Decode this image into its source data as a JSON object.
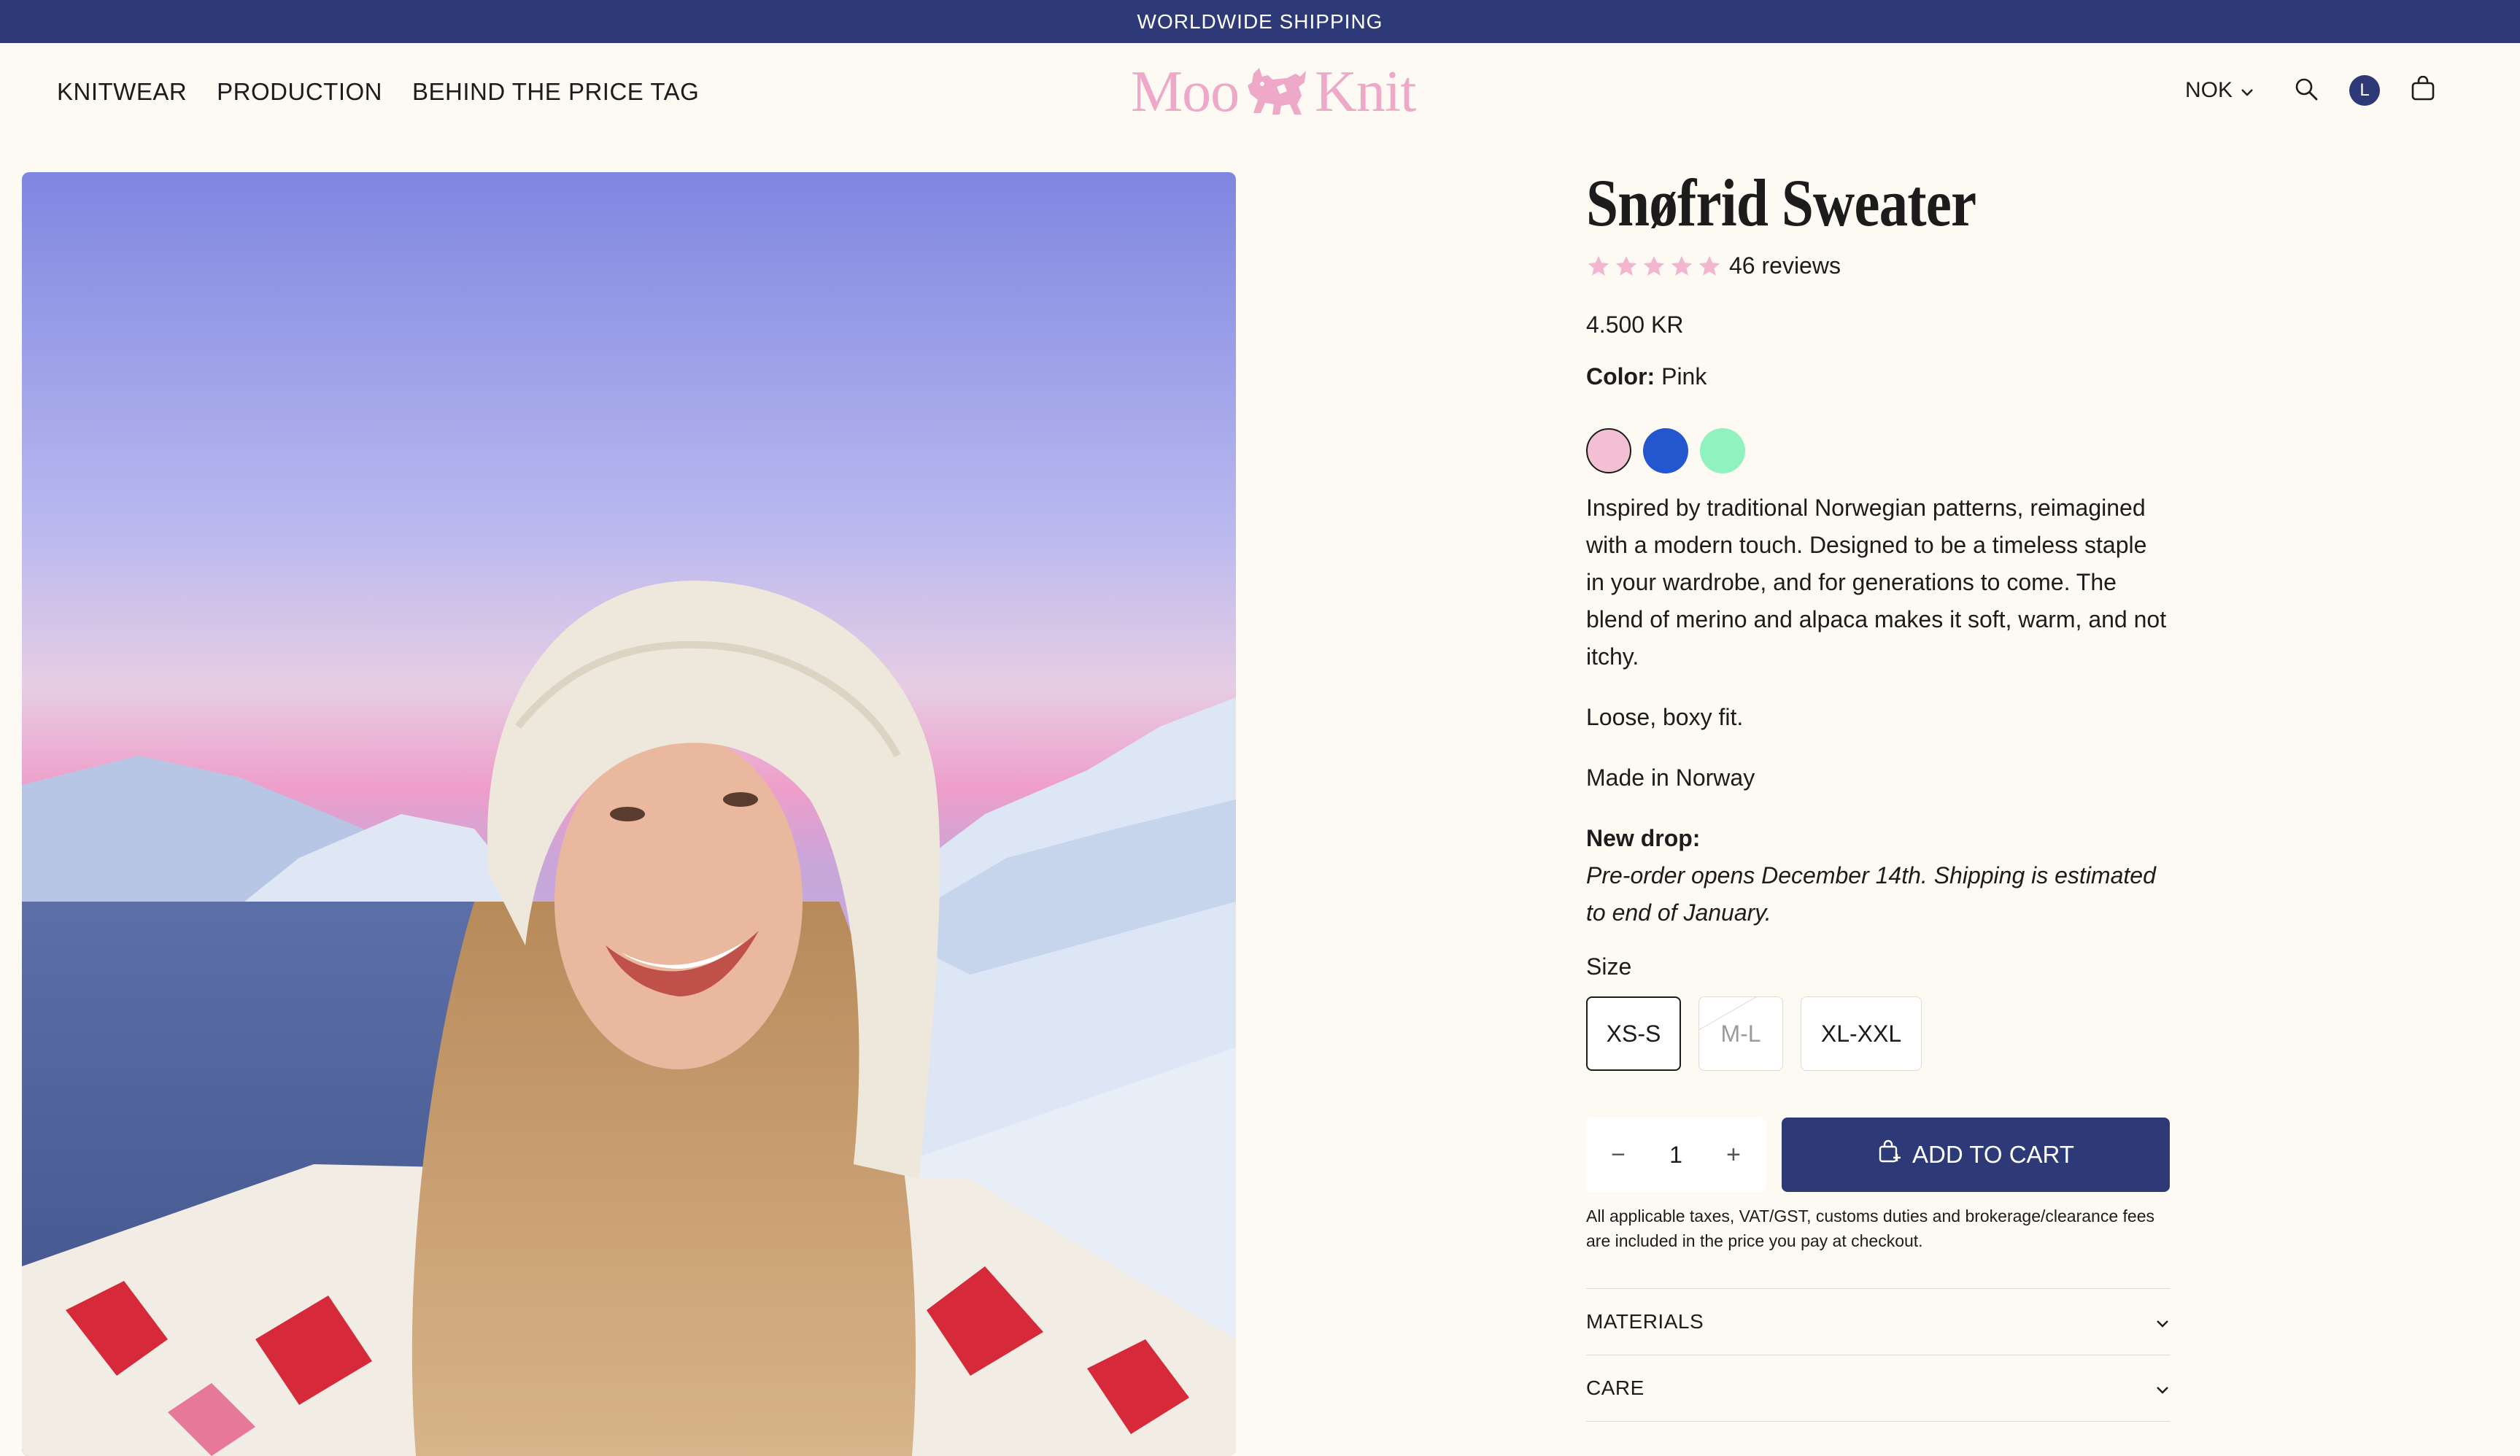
{
  "announcement": "WORLDWIDE SHIPPING",
  "nav": {
    "items": [
      "KNITWEAR",
      "PRODUCTION",
      "BEHIND THE PRICE TAG"
    ]
  },
  "logo": {
    "left_text": "Moo",
    "right_text": "Knit",
    "icon": "cow-icon",
    "color": "#eea8c8"
  },
  "header": {
    "currency": "NOK",
    "avatar_initial": "L",
    "icons": [
      "chevron-down-icon",
      "search-icon",
      "account-avatar",
      "shopping-bag-icon"
    ]
  },
  "product": {
    "title": "Snøfrid Sweater",
    "rating": 5,
    "reviews": "46 reviews",
    "price": "4.500 KR",
    "color_label": "Color:",
    "color_value": "Pink",
    "swatches": [
      {
        "name": "Pink",
        "hex": "#f2bfd3",
        "selected": true
      },
      {
        "name": "Blue",
        "hex": "#2456cf",
        "selected": false
      },
      {
        "name": "Mint",
        "hex": "#8ff2bf",
        "selected": false
      }
    ],
    "description": "Inspired by traditional Norwegian patterns, reimagined with a modern touch. Designed to be a timeless staple in your wardrobe, and for generations to come. The blend of merino and alpaca makes it soft, warm, and not itchy.",
    "fit": "Loose, boxy fit.",
    "origin": "Made in Norway",
    "drop_title": "New drop:",
    "drop_text": "Pre-order opens December 14th. Shipping is estimated to end of January.",
    "size_label": "Size",
    "sizes": [
      {
        "label": "XS-S",
        "state": "selected"
      },
      {
        "label": "M-L",
        "state": "unavailable"
      },
      {
        "label": "XL-XXL",
        "state": "available"
      }
    ],
    "quantity": "1",
    "qty_minus": "−",
    "qty_plus": "+",
    "add_to_cart": "ADD TO CART",
    "tax_note": "All applicable taxes, VAT/GST, customs duties and brokerage/clearance fees are included in the price you pay at checkout.",
    "accordions": [
      "MATERIALS",
      "CARE"
    ]
  },
  "colors": {
    "brand_navy": "#2e3a78",
    "star_pink": "#f2b6cf",
    "background": "#fdf9f3"
  }
}
